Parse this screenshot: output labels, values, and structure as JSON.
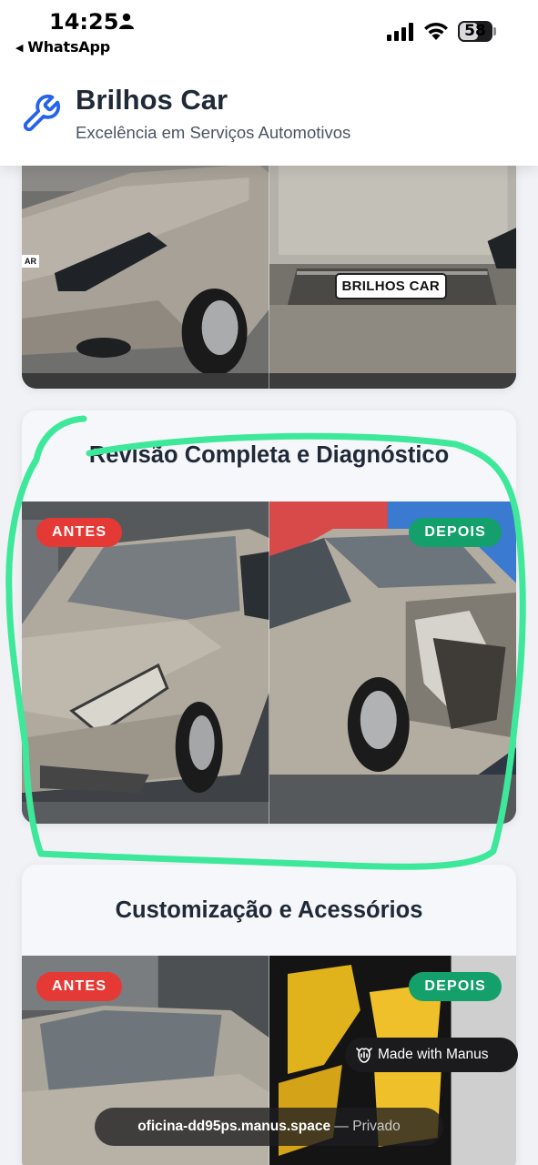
{
  "status_bar": {
    "time": "14:25",
    "back_app": "WhatsApp",
    "battery_level": "58",
    "battery_fraction": 0.58
  },
  "header": {
    "brand": "Brilhos Car",
    "tagline": "Excelência em Serviços Automotivos",
    "accent_color": "#2563eb"
  },
  "cards": [
    {
      "title": "",
      "photo_caption": "BRILHOS CAR",
      "photo_caption_partial": "AR"
    },
    {
      "title": "Revisão Completa e Diagnóstico",
      "before_label": "ANTES",
      "after_label": "DEPOIS"
    },
    {
      "title": "Customização e Acessórios",
      "before_label": "ANTES",
      "after_label": "DEPOIS"
    }
  ],
  "badge_colors": {
    "before": "#e53935",
    "after": "#14a06a"
  },
  "annotation_color": "#3ee89a",
  "overlay": {
    "made_with": "Made with Manus",
    "url": "oficina-dd95ps.manus.space",
    "privacy": "— Privado"
  }
}
